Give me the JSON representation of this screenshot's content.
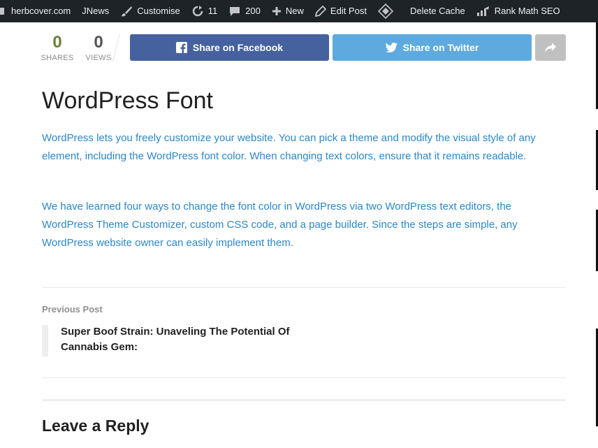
{
  "adminbar": {
    "site_name": "herbcover.com",
    "jnews": "JNews",
    "customise": "Customise",
    "updates_count": "11",
    "comments_count": "200",
    "new_label": "New",
    "edit_post": "Edit Post",
    "delete_cache": "Delete Cache",
    "rank_math": "Rank Math SEO"
  },
  "share": {
    "shares_count": "0",
    "shares_label": "SHARES",
    "views_count": "0",
    "views_label": "VIEWS",
    "facebook_label": "Share on Facebook",
    "twitter_label": "Share on Twitter"
  },
  "article": {
    "title": "WordPress Font",
    "paragraph1": "WordPress lets you freely customize your website. You can pick a theme and modify the visual style of any element, including the WordPress font color. When changing text colors, ensure that it remains readable.",
    "paragraph2": "We have learned four ways to change the font color in WordPress via two WordPress text editors, the WordPress Theme Customizer, custom CSS code, and a page builder. Since the steps are simple, any WordPress website owner can easily implement them."
  },
  "navigation": {
    "previous_label": "Previous Post",
    "previous_title": "Super Boof Strain: Unaveling The Potential Of Cannabis Gem:"
  },
  "comments": {
    "heading": "Leave a Reply"
  },
  "colors": {
    "adminbar_bg": "#1d2327",
    "facebook": "#45629f",
    "twitter": "#5eaade",
    "link_text": "#2b87c7"
  }
}
